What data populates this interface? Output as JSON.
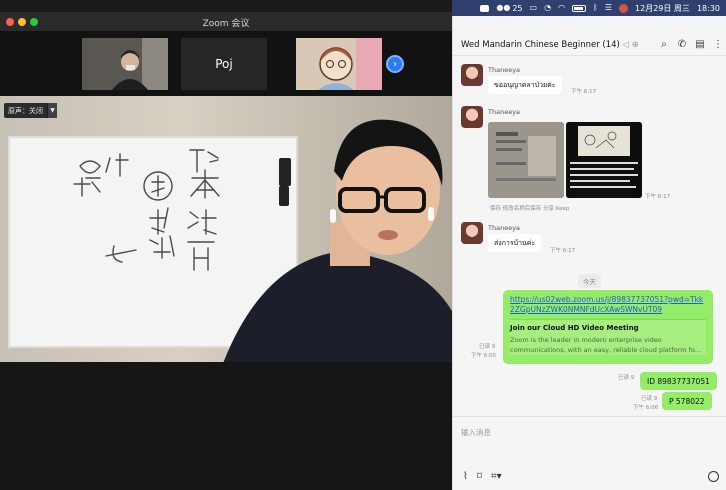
{
  "menubar": {
    "wechat_count": "25",
    "datetime": "12月29日 周三",
    "clock": "18:30"
  },
  "zoom": {
    "title": "Zoom 会议",
    "participant_name": "Poj",
    "audio_label": "原声：关闭"
  },
  "chat": {
    "title": "Wed Mandarin Chinese Beginner (14)",
    "messages": [
      {
        "sender": "Thaneeya",
        "text": "ขออนุญาตลาป่วยค่ะ",
        "time": "下午 6:17"
      },
      {
        "sender": "Thaneeya",
        "time": "下午 6:17",
        "actions": "保存  修改名称后保存  分享  Keep"
      },
      {
        "sender": "Thaneeya",
        "text": "ส่งการบ้านค่ะ",
        "time": "下午 6:17"
      }
    ],
    "day_separator": "今天",
    "link": {
      "url": "https://us02web.zoom.us/j/89837737051?pwd=Tkk2ZGpUNzZWK0NMNFdUcXAwSWNvUT09",
      "card_title": "Join our Cloud HD Video Meeting",
      "card_desc": "Zoom is the leader in modern enterprise video communications, with an easy, reliable cloud platform fo...",
      "read": "已读 9",
      "time": "下午 6:05"
    },
    "out_messages": [
      {
        "text": "ID 89837737051",
        "read": "已读 9"
      },
      {
        "text": "P 578022",
        "read": "已读 9",
        "time": "下午 6:06"
      }
    ],
    "input_placeholder": "输入消息"
  }
}
